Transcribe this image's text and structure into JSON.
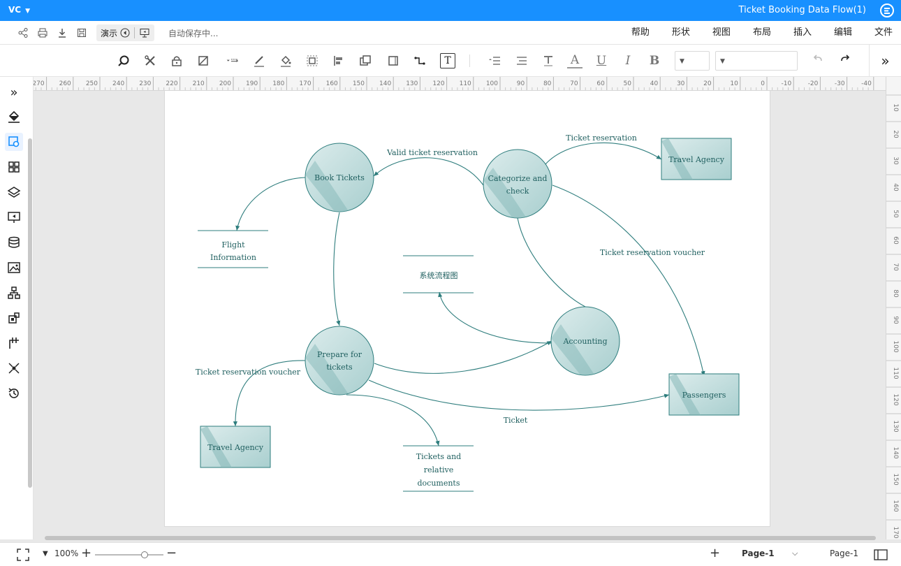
{
  "app": {
    "title": "Ticket Booking Data Flow(1)",
    "user_initials": "VC"
  },
  "menu": {
    "items": [
      "文件",
      "编辑",
      "插入",
      "布局",
      "视图",
      "形状",
      "帮助"
    ]
  },
  "quickbar": {
    "present_label": "演示",
    "autosave_status": "自动保存中..."
  },
  "toolbar": {
    "bold": "B",
    "italic": "I",
    "underline": "U",
    "font_color": "A",
    "text_tool": "T"
  },
  "ruler": {
    "h_labels": [
      "-40",
      "-30",
      "-20",
      "-10",
      "0",
      "10",
      "20",
      "30",
      "40",
      "50",
      "60",
      "70",
      "80",
      "90",
      "100",
      "110",
      "120",
      "130",
      "140",
      "150",
      "160",
      "170",
      "180",
      "190",
      "200",
      "210",
      "220",
      "230",
      "240",
      "250",
      "260",
      "270"
    ],
    "v_labels": [
      "10",
      "20",
      "30",
      "40",
      "50",
      "60",
      "70",
      "80",
      "90",
      "100",
      "110",
      "120",
      "130",
      "140",
      "150",
      "160",
      "170"
    ]
  },
  "diagram": {
    "processes": {
      "categorize": "Categorize and check",
      "book": "Book Tickets",
      "prepare": "Prepare for tickets",
      "accounting": "Accounting"
    },
    "entities": {
      "travel_agency_top": "Travel Agency",
      "passengers": "Passengers",
      "travel_agency_bottom": "Travel Agency"
    },
    "stores": {
      "flight": "Flight Information",
      "system": "系统流程图",
      "tickets_docs": "Tickets and relative documents"
    },
    "flows": {
      "valid_reservation": "Valid ticket reservation",
      "ticket_reservation": "Ticket reservation",
      "voucher_right": "Ticket reservation voucher",
      "voucher_left": "Ticket reservation voucher",
      "ticket": "Ticket"
    }
  },
  "status": {
    "page_selector": "Page-1",
    "page_tab": "Page-1",
    "zoom": "100%"
  },
  "colors": {
    "brand": "#1890ff",
    "shape_stroke": "#2e7d7d",
    "shape_fill": "#a9cfcf",
    "text": "#1f5f5f"
  }
}
